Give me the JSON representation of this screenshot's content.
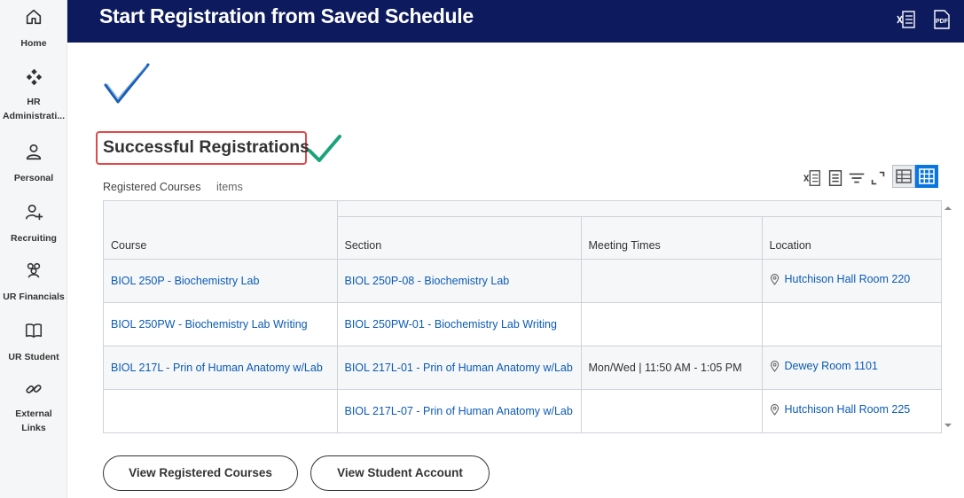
{
  "sidebar": {
    "items": [
      {
        "label": "Home",
        "icon": "home-icon"
      },
      {
        "label": "HR Administrati...",
        "label_line1": "HR",
        "label_line2": "Administrati...",
        "icon": "hr-admin-icon"
      },
      {
        "label": "Personal",
        "icon": "person-icon"
      },
      {
        "label": "Recruiting",
        "icon": "add-person-icon"
      },
      {
        "label": "UR Financials",
        "icon": "group-icon"
      },
      {
        "label": "UR Student",
        "icon": "book-icon"
      },
      {
        "label": "External Links",
        "label_line1": "External",
        "label_line2": "Links",
        "icon": "link-icon"
      }
    ]
  },
  "header": {
    "title": "Start Registration from Saved Schedule",
    "icons": [
      "excel-export-icon",
      "pdf-export-icon"
    ],
    "pdf_text": "PDF",
    "background": "#0d1b5e"
  },
  "main": {
    "section_title": "Successful Registrations",
    "grid": {
      "caption": "Registered Courses",
      "count_label": "items",
      "columns": [
        "Course",
        "Section",
        "Meeting Times",
        "Location"
      ],
      "rows": [
        {
          "course": "BIOL 250P - Biochemistry Lab",
          "section": "BIOL 250P-08 - Biochemistry Lab",
          "meeting": "",
          "location": "Hutchison Hall Room 220"
        },
        {
          "course": "BIOL 250PW - Biochemistry Lab Writing",
          "section": "BIOL 250PW-01 - Biochemistry Lab Writing",
          "meeting": "",
          "location": ""
        },
        {
          "course": "BIOL 217L - Prin of Human Anatomy w/Lab",
          "section": "BIOL 217L-01 - Prin of Human Anatomy w/Lab",
          "meeting": "Mon/Wed | 11:50 AM - 1:05 PM",
          "location": "Dewey Room 1101"
        },
        {
          "course": "",
          "section": "BIOL 217L-07 - Prin of Human Anatomy w/Lab",
          "meeting": "",
          "location": "Hutchison Hall Room 225"
        }
      ]
    },
    "buttons": {
      "view_registered": "View Registered Courses",
      "view_account": "View Student Account"
    }
  },
  "colors": {
    "link": "#0b5bb5",
    "accent_blue": "#0875e1",
    "success_green": "#1aa37a",
    "highlight_red": "#e04a4a"
  }
}
